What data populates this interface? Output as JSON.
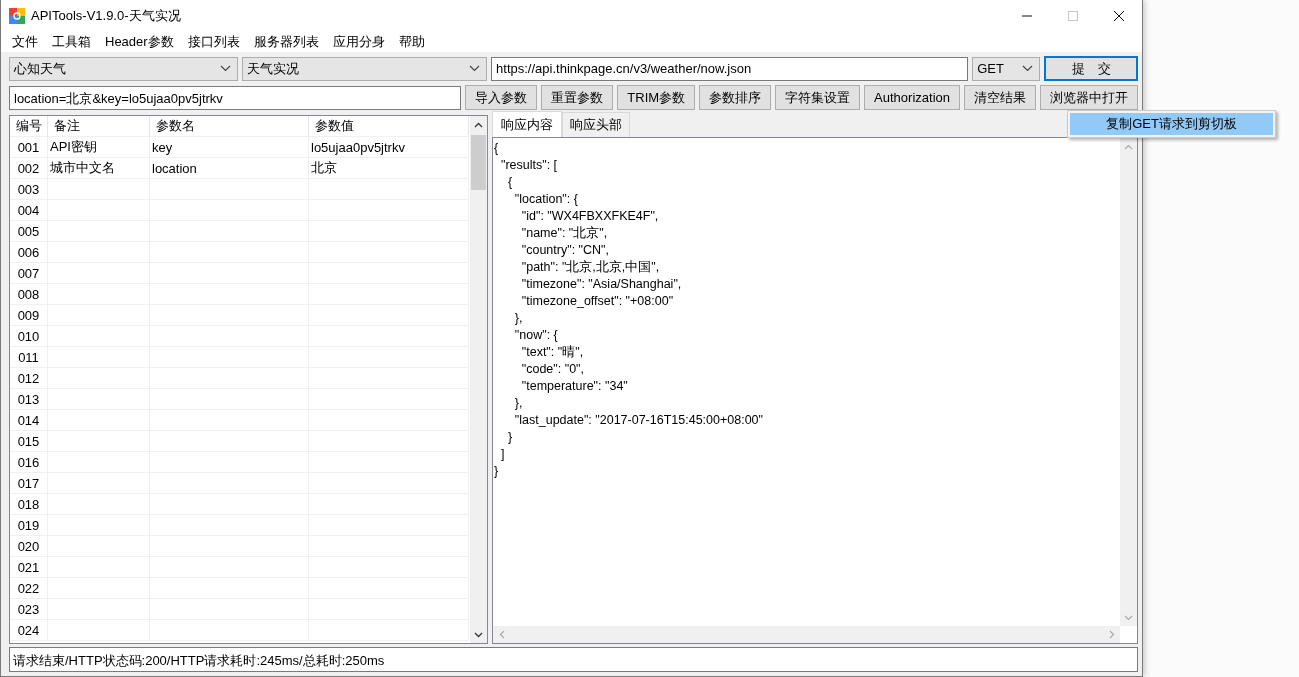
{
  "window": {
    "title": "APITools-V1.9.0-天气实况",
    "controls": [
      {
        "kind": "minimize",
        "disabled": false
      },
      {
        "kind": "maximize",
        "disabled": true
      },
      {
        "kind": "close",
        "disabled": false
      }
    ]
  },
  "menu": [
    "文件",
    "工具箱",
    "Header参数",
    "接口列表",
    "服务器列表",
    "应用分身",
    "帮助"
  ],
  "request": {
    "provider": "心知天气",
    "api": "天气实况",
    "url": "https://api.thinkpage.cn/v3/weather/now.json",
    "method": "GET",
    "submit": "提　交",
    "params": "location=北京&key=lo5ujaa0pv5jtrkv"
  },
  "toolbar": [
    "导入参数",
    "重置参数",
    "TRIM参数",
    "参数排序",
    "字符集设置",
    "Authorization",
    "清空结果",
    "浏览器中打开"
  ],
  "context_menu": [
    {
      "label": "复制GET请求到剪切板",
      "highlighted": true
    }
  ],
  "table": {
    "columns": [
      "编号",
      "备注",
      "参数名",
      "参数值"
    ],
    "rows": [
      {
        "no": "001",
        "remark": "API密钥",
        "name": "key",
        "value": "lo5ujaa0pv5jtrkv"
      },
      {
        "no": "002",
        "remark": "城市中文名",
        "name": "location",
        "value": "北京"
      },
      {
        "no": "003"
      },
      {
        "no": "004"
      },
      {
        "no": "005"
      },
      {
        "no": "006"
      },
      {
        "no": "007"
      },
      {
        "no": "008"
      },
      {
        "no": "009"
      },
      {
        "no": "010"
      },
      {
        "no": "011"
      },
      {
        "no": "012"
      },
      {
        "no": "013"
      },
      {
        "no": "014"
      },
      {
        "no": "015"
      },
      {
        "no": "016"
      },
      {
        "no": "017"
      },
      {
        "no": "018"
      },
      {
        "no": "019"
      },
      {
        "no": "020"
      },
      {
        "no": "021"
      },
      {
        "no": "022"
      },
      {
        "no": "023"
      },
      {
        "no": "024"
      }
    ]
  },
  "tabs": [
    {
      "label": "响应内容",
      "selected": true
    },
    {
      "label": "响应头部",
      "selected": false
    }
  ],
  "response_lines": [
    "{",
    "  \"results\": [",
    "    {",
    "      \"location\": {",
    "        \"id\": \"WX4FBXXFKE4F\",",
    "        \"name\": \"北京\",",
    "        \"country\": \"CN\",",
    "        \"path\": \"北京,北京,中国\",",
    "        \"timezone\": \"Asia/Shanghai\",",
    "        \"timezone_offset\": \"+08:00\"",
    "      },",
    "      \"now\": {",
    "        \"text\": \"晴\",",
    "        \"code\": \"0\",",
    "        \"temperature\": \"34\"",
    "      },",
    "      \"last_update\": \"2017-07-16T15:45:00+08:00\"",
    "    }",
    "  ]",
    "}"
  ],
  "status_bar": "请求结束/HTTP状态码:200/HTTP请求耗时:245ms/总耗时:250ms"
}
